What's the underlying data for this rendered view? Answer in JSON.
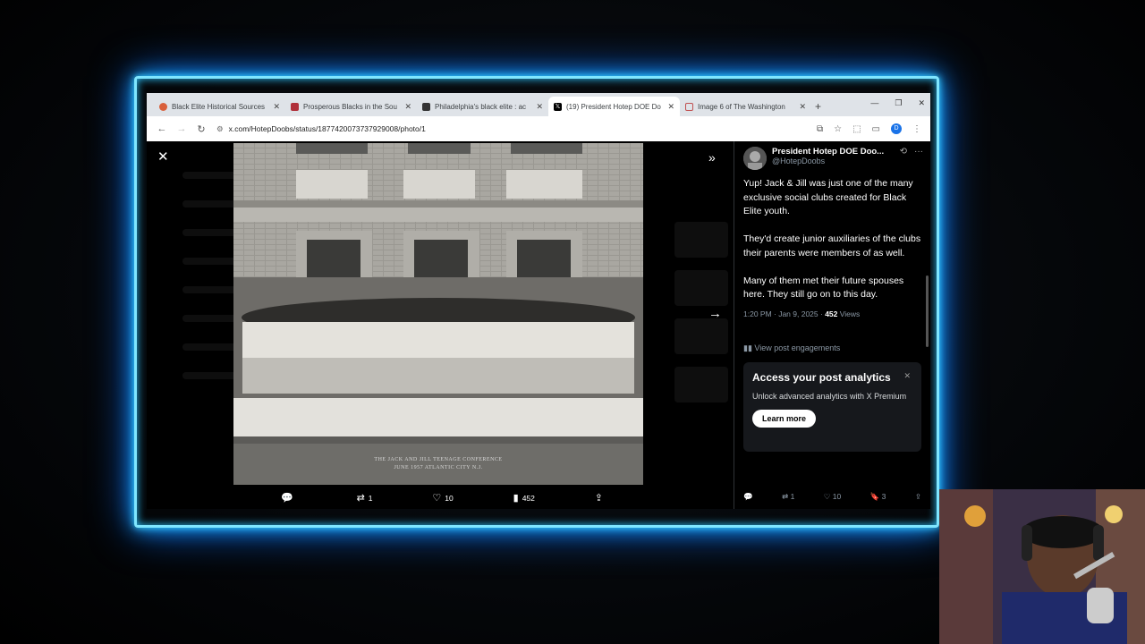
{
  "tabs": [
    {
      "label": "Black Elite Historical Sources",
      "fav_color": "#d9603b",
      "active": false
    },
    {
      "label": "Prosperous Blacks in the Sou",
      "fav_color": "#b0303a",
      "active": false
    },
    {
      "label": "Philadelphia's black elite : ac",
      "fav_color": "#333333",
      "active": false
    },
    {
      "label": "(19) President Hotep DOE Do",
      "fav_color": "#000000",
      "active": true
    },
    {
      "label": "Image 6 of The Washington",
      "fav_color": "#c05050",
      "active": false
    }
  ],
  "address": {
    "url": "x.com/HotepDoobs/status/1877420073737929008/photo/1"
  },
  "photo": {
    "caption_line1": "THE JACK AND JILL TEENAGE CONFERENCE",
    "caption_line2": "JUNE  1957          ATLANTIC CITY N.J."
  },
  "viewer_actions": {
    "replies": "",
    "reposts": "1",
    "likes": "10",
    "views": "452"
  },
  "post": {
    "name": "President Hotep DOE Doo...",
    "handle": "@HotepDoobs",
    "paragraphs": [
      "Yup! Jack & Jill was just one of the many exclusive social clubs created for Black Elite youth.",
      "They'd create junior auxiliaries of the clubs their parents were members of as well.",
      "Many of them met their future spouses here. They still go on to this day."
    ],
    "timestamp": "1:20 PM · Jan 9, 2025 · ",
    "views_count": "452",
    "views_label": " Views",
    "engagements": "View post engagements"
  },
  "premium": {
    "title": "Access your post analytics",
    "body": "Unlock advanced analytics with X Premium",
    "button": "Learn more"
  },
  "panel_actions": {
    "reposts": "1",
    "likes": "10",
    "bookmarks": "3"
  }
}
